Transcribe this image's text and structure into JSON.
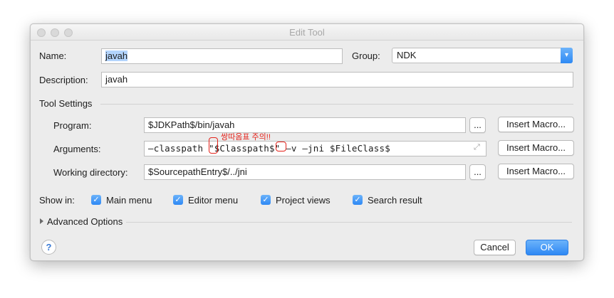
{
  "window": {
    "title": "Edit Tool"
  },
  "form": {
    "name_label": "Name:",
    "name_value": "javah",
    "group_label": "Group:",
    "group_value": "NDK",
    "description_label": "Description:",
    "description_value": "javah"
  },
  "tool_settings": {
    "section_title": "Tool Settings",
    "program_label": "Program:",
    "program_value": "$JDKPath$/bin/javah",
    "arguments_label": "Arguments:",
    "arguments_value": "—classpath \"$Classpath$\" —v —jni $FileClass$",
    "working_dir_label": "Working directory:",
    "working_dir_value": "$SourcepathEntry$/../jni",
    "browse_label": "...",
    "insert_macro_label": "Insert Macro..."
  },
  "annotation": {
    "text": "쌍따옴표 주의!!"
  },
  "show_in": {
    "label": "Show in:",
    "options": [
      {
        "label": "Main menu",
        "checked": true
      },
      {
        "label": "Editor menu",
        "checked": true
      },
      {
        "label": "Project views",
        "checked": true
      },
      {
        "label": "Search result",
        "checked": true
      }
    ]
  },
  "advanced": {
    "label": "Advanced Options"
  },
  "footer": {
    "help": "?",
    "cancel": "Cancel",
    "ok": "OK"
  }
}
